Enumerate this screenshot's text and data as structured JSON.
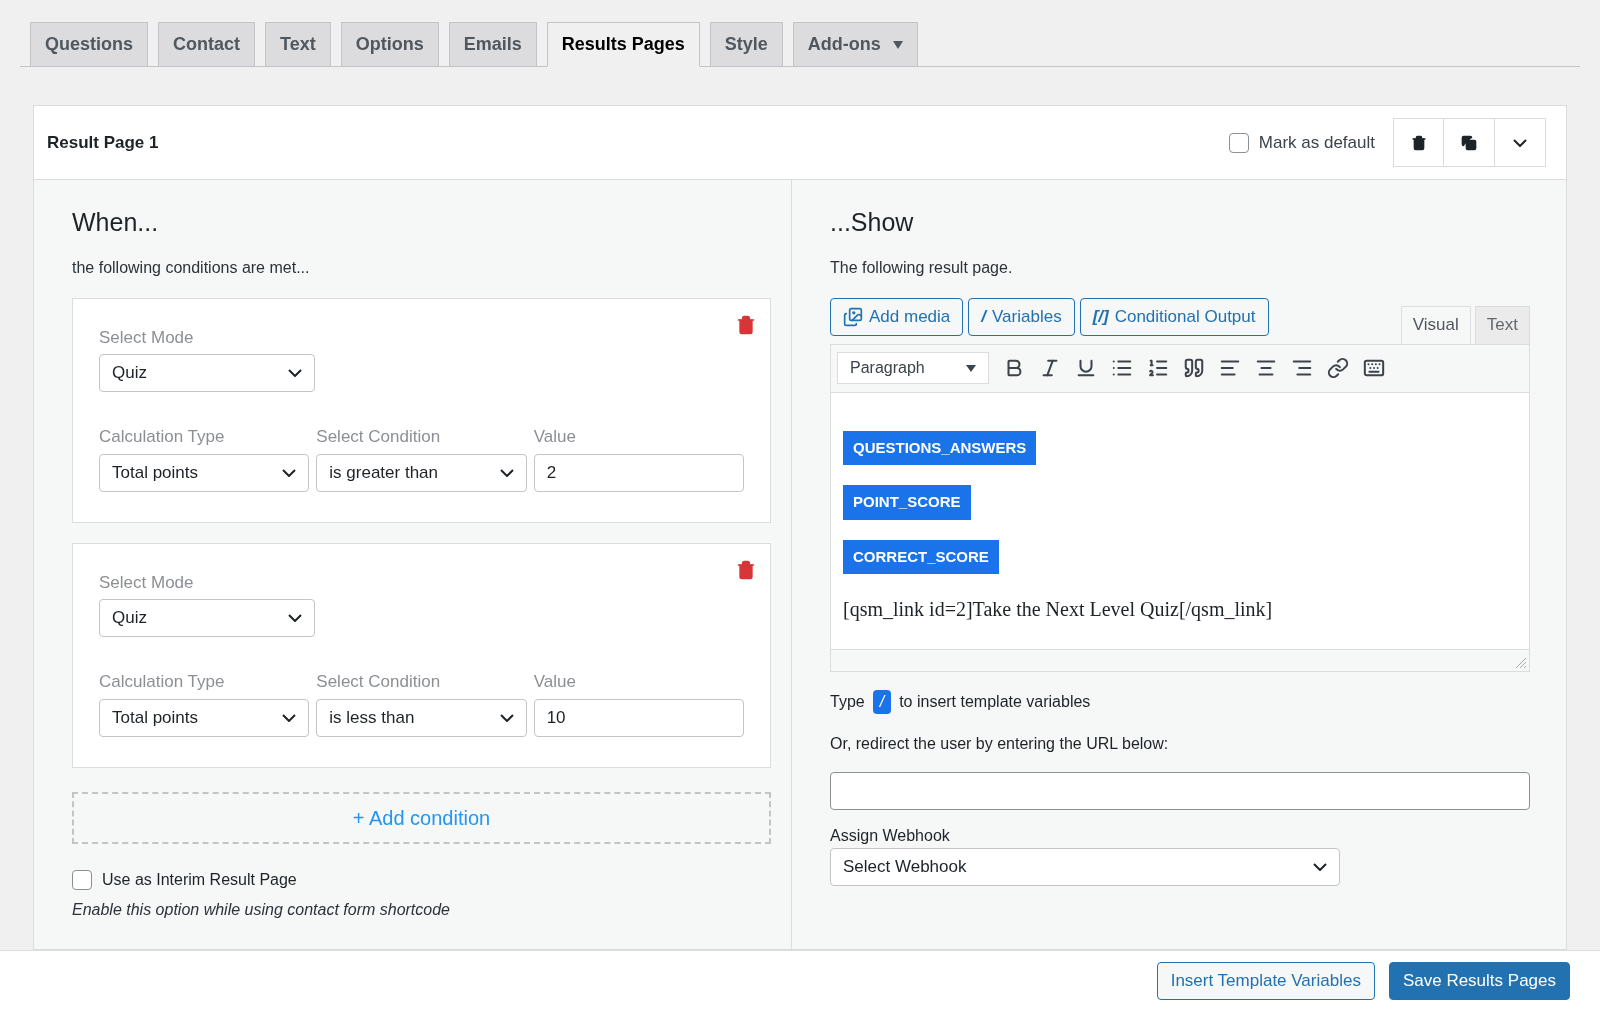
{
  "tabs": [
    {
      "label": "Questions",
      "selected": false
    },
    {
      "label": "Contact",
      "selected": false
    },
    {
      "label": "Text",
      "selected": false
    },
    {
      "label": "Options",
      "selected": false
    },
    {
      "label": "Emails",
      "selected": false
    },
    {
      "label": "Results Pages",
      "selected": true
    },
    {
      "label": "Style",
      "selected": false
    },
    {
      "label": "Add-ons",
      "selected": false,
      "has_menu": true
    }
  ],
  "result_page": {
    "title": "Result Page 1",
    "mark_default": {
      "label": "Mark as default",
      "checked": false
    }
  },
  "when": {
    "heading": "When...",
    "subtitle": "the following conditions are met...",
    "conditions": [
      {
        "mode_label": "Select Mode",
        "mode": "Quiz",
        "calc_label": "Calculation Type",
        "calc": "Total points",
        "cond_label": "Select Condition",
        "cond": "is greater than",
        "value_label": "Value",
        "value": "2"
      },
      {
        "mode_label": "Select Mode",
        "mode": "Quiz",
        "calc_label": "Calculation Type",
        "calc": "Total points",
        "cond_label": "Select Condition",
        "cond": "is less than",
        "value_label": "Value",
        "value": "10"
      }
    ],
    "add_condition": "+ Add condition",
    "interim": {
      "label": "Use as Interim Result Page",
      "checked": false
    },
    "hint": "Enable this option while using contact form shortcode"
  },
  "show": {
    "heading": "...Show",
    "subtitle": "The following result page.",
    "media_buttons": [
      {
        "kind": "media",
        "label": "Add media"
      },
      {
        "kind": "glyph",
        "glyph": "/",
        "label": "Variables"
      },
      {
        "kind": "glyph",
        "glyph": "[/]",
        "label": "Conditional Output"
      }
    ],
    "editor_tabs": [
      {
        "label": "Visual",
        "selected": true
      },
      {
        "label": "Text",
        "selected": false
      }
    ],
    "format": "Paragraph",
    "variables": [
      "QUESTIONS_ANSWERS",
      "POINT_SCORE",
      "CORRECT_SCORE"
    ],
    "content": "[qsm_link id=2]Take the Next Level Quiz[/qsm_link]",
    "type_hint": {
      "before": "Type",
      "key": "/",
      "after": "to insert template variables"
    },
    "redirect_label": "Or, redirect the user by entering the URL below:",
    "webhook_label": "Assign Webhook",
    "webhook": "Select Webhook"
  },
  "footer_buttons": [
    {
      "label": "Insert Template Variables",
      "kind": "secondary"
    },
    {
      "label": "Save Results Pages",
      "kind": "primary"
    }
  ]
}
